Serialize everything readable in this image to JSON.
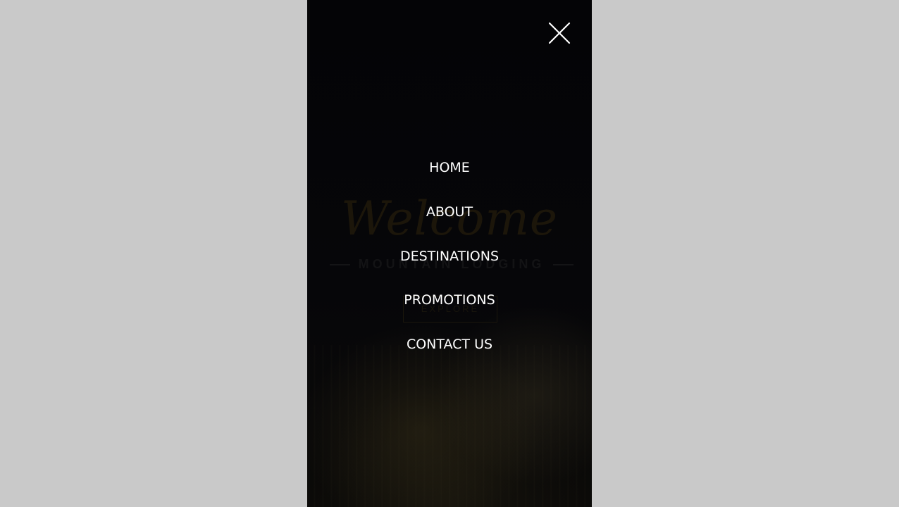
{
  "hero": {
    "welcome": "Welcome",
    "subtitle": "MOUNTAIN LODGING",
    "explore_label": "EXPLORE"
  },
  "menu": {
    "close_icon": "close-icon",
    "items": [
      {
        "label": "HOME"
      },
      {
        "label": "ABOUT"
      },
      {
        "label": "DESTINATIONS"
      },
      {
        "label": "PROMOTIONS"
      },
      {
        "label": "CONTACT US"
      }
    ]
  },
  "colors": {
    "page_background": "#c9c9c9",
    "overlay": "#050508",
    "menu_text": "#ffffff"
  }
}
